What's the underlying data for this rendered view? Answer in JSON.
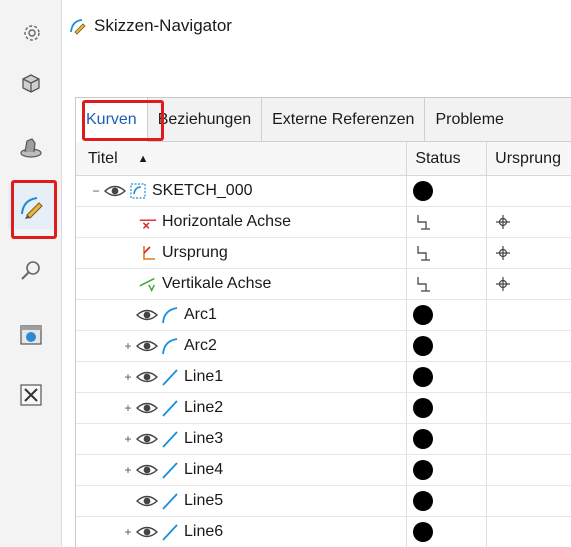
{
  "header": {
    "title": "Skizzen-Navigator",
    "icon": "sketch-navigator-icon"
  },
  "sidebar": {
    "items": [
      {
        "name": "settings",
        "icon": "gear-icon"
      },
      {
        "name": "part-navigator",
        "icon": "part-cube-icon"
      },
      {
        "name": "assembly",
        "icon": "assembly-icon"
      },
      {
        "name": "sketch-navigator",
        "icon": "sketch-pencil-icon",
        "active": true
      },
      {
        "name": "search",
        "icon": "magnifier-icon"
      },
      {
        "name": "web-browser",
        "icon": "browser-globe-icon"
      },
      {
        "name": "tools",
        "icon": "tools-icon"
      }
    ]
  },
  "tabs": [
    {
      "label": "Kurven",
      "active": true
    },
    {
      "label": "Beziehungen"
    },
    {
      "label": "Externe Referenzen"
    },
    {
      "label": "Probleme"
    }
  ],
  "columns": {
    "title": "Titel",
    "status": "Status",
    "origin": "Ursprung"
  },
  "rows": [
    {
      "label": "SKETCH_000",
      "expander": "−",
      "eye": true,
      "icon": "sketch-icon",
      "status": "dot",
      "origin": ""
    },
    {
      "label": "Horizontale Achse",
      "expander": "",
      "eye": false,
      "icon": "horizontal-axis-icon",
      "status": "reference",
      "origin": "anchor"
    },
    {
      "label": "Ursprung",
      "expander": "",
      "eye": false,
      "icon": "origin-icon",
      "status": "reference",
      "origin": "anchor"
    },
    {
      "label": "Vertikale Achse",
      "expander": "",
      "eye": false,
      "icon": "vertical-axis-icon",
      "status": "reference",
      "origin": "anchor"
    },
    {
      "label": "Arc1",
      "expander": "",
      "eye": true,
      "icon": "arc-icon",
      "status": "dot",
      "origin": ""
    },
    {
      "label": "Arc2",
      "expander": "+",
      "eye": true,
      "icon": "arc-icon",
      "status": "dot",
      "origin": ""
    },
    {
      "label": "Line1",
      "expander": "+",
      "eye": true,
      "icon": "line-icon",
      "status": "dot",
      "origin": ""
    },
    {
      "label": "Line2",
      "expander": "+",
      "eye": true,
      "icon": "line-icon",
      "status": "dot",
      "origin": ""
    },
    {
      "label": "Line3",
      "expander": "+",
      "eye": true,
      "icon": "line-icon",
      "status": "dot",
      "origin": ""
    },
    {
      "label": "Line4",
      "expander": "+",
      "eye": true,
      "icon": "line-icon",
      "status": "dot",
      "origin": ""
    },
    {
      "label": "Line5",
      "expander": "",
      "eye": true,
      "icon": "line-icon",
      "status": "dot",
      "origin": ""
    },
    {
      "label": "Line6",
      "expander": "+",
      "eye": true,
      "icon": "line-icon",
      "status": "dot",
      "origin": ""
    }
  ],
  "colors": {
    "highlight": "#e01b1b",
    "curve": "#1a8fd6",
    "axis_red": "#d8232a",
    "axis_green": "#3aa83a",
    "origin_orange": "#e07b17"
  }
}
